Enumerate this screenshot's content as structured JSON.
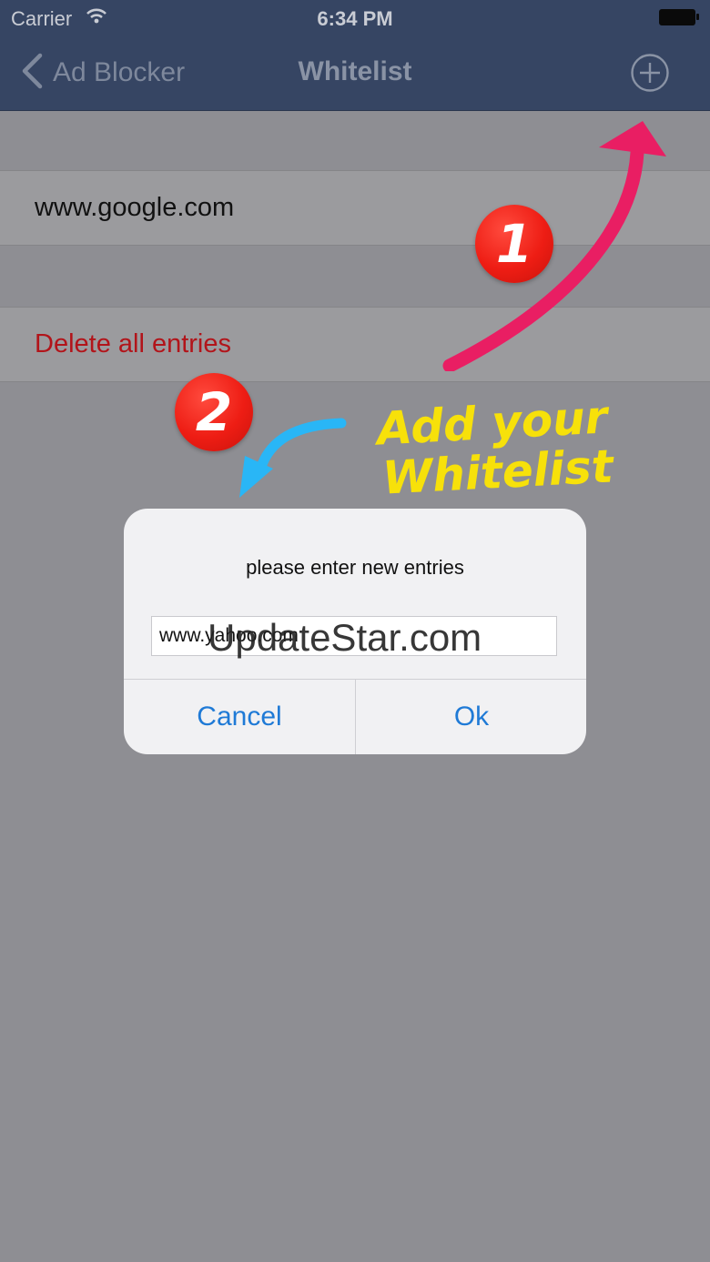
{
  "status_bar": {
    "carrier": "Carrier",
    "time": "6:34 PM"
  },
  "nav": {
    "back_label": "Ad Blocker",
    "title": "Whitelist",
    "add_icon": "plus-circle-icon"
  },
  "list": {
    "entries": [
      "www.google.com"
    ],
    "delete_all_label": "Delete all entries"
  },
  "annotations": {
    "step_1": "1",
    "step_2": "2",
    "caption_line1": "Add your",
    "caption_line2": "Whitelist",
    "arrow_1_color": "#e91e63",
    "arrow_2_color": "#29b6f6"
  },
  "dialog": {
    "message": "please enter new entries",
    "input_value": "www.yahoo.com",
    "watermark": "UpdateStar.com",
    "cancel_label": "Cancel",
    "ok_label": "Ok"
  },
  "colors": {
    "nav_bg": "#364563",
    "dim_bg": "#8e8e93",
    "destructive": "#b2141a",
    "ios_blue": "#1f7ad6",
    "badge_red": "#ee1d14",
    "caption_yellow": "#f7e10a"
  }
}
